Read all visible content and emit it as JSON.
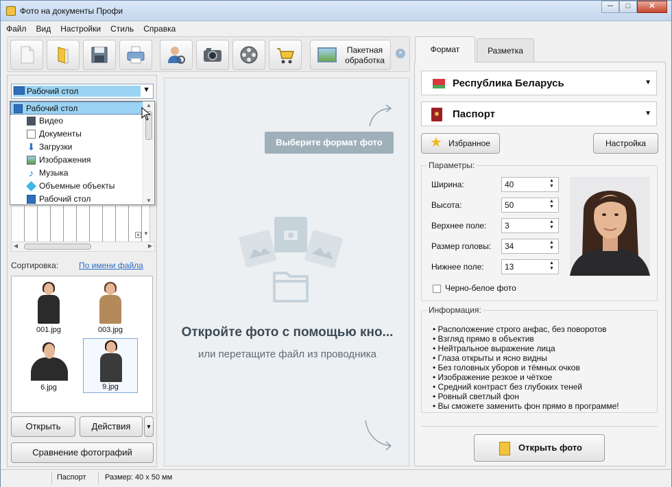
{
  "window": {
    "title": "Фото на документы Профи",
    "buttons": [
      "─",
      "□",
      "✕"
    ]
  },
  "menu": [
    "Файл",
    "Вид",
    "Настройки",
    "Стиль",
    "Справка"
  ],
  "toolbar": {
    "icons": [
      "new-document-icon",
      "open-folder-icon",
      "save-disk-icon",
      "print-icon",
      "person-search-icon",
      "camera-icon",
      "film-reel-icon",
      "cart-icon"
    ],
    "batch_label_1": "Пакетная",
    "batch_label_2": "обработка"
  },
  "left": {
    "combo_value": "Рабочий стол",
    "dropdown_items": [
      {
        "label": "Рабочий стол",
        "icon": "desktop-icon",
        "highlight": true
      },
      {
        "label": "Видео",
        "icon": "video-icon"
      },
      {
        "label": "Документы",
        "icon": "documents-icon"
      },
      {
        "label": "Загрузки",
        "icon": "downloads-icon"
      },
      {
        "label": "Изображения",
        "icon": "images-icon"
      },
      {
        "label": "Музыка",
        "icon": "music-icon"
      },
      {
        "label": "Объемные объекты",
        "icon": "3d-objects-icon"
      },
      {
        "label": "Рабочий стол",
        "icon": "desktop-icon"
      }
    ],
    "sort_label": "Сортировка:",
    "sort_value": "По имени файла",
    "thumbnails": [
      "001.jpg",
      "003.jpg",
      "6.jpg",
      "9.jpg"
    ],
    "open_button": "Открыть",
    "actions_button": "Действия",
    "compare_button": "Сравнение фотографий"
  },
  "center": {
    "hint": "Выберите формат фото",
    "open_title": "Откройте фото с помощью кно...",
    "open_sub": "или перетащите файл из проводника"
  },
  "right": {
    "tabs": [
      "Формат",
      "Разметка"
    ],
    "country": "Республика Беларусь",
    "document": "Паспорт",
    "favorites_button": "Избранное",
    "settings_button": "Настройка",
    "params_title": "Параметры:",
    "params": [
      {
        "label": "Ширина:",
        "value": "40"
      },
      {
        "label": "Высота:",
        "value": "50"
      },
      {
        "label": "Верхнее поле:",
        "value": "3"
      },
      {
        "label": "Размер головы:",
        "value": "34"
      },
      {
        "label": "Нижнее поле:",
        "value": "13"
      }
    ],
    "bw_label": "Черно-белое фото",
    "info_title": "Информация:",
    "info_items": [
      "Расположение строго анфас, без поворотов",
      "Взгляд прямо в объектив",
      "Нейтральное выражение лица",
      "Глаза открыты и ясно видны",
      "Без головных уборов и тёмных очков",
      "Изображение резкое и чёткое",
      "Средний контраст без глубоких теней",
      "Ровный светлый фон",
      "Вы сможете заменить фон прямо в программе!"
    ],
    "open_photo_button": "Открыть фото"
  },
  "status": {
    "doc": "Паспорт",
    "size": "Размер: 40 x 50 мм"
  },
  "colors": {
    "accent": "#9ad3f3",
    "hint_bg": "#9fb0bb",
    "link": "#2b6cc4"
  }
}
